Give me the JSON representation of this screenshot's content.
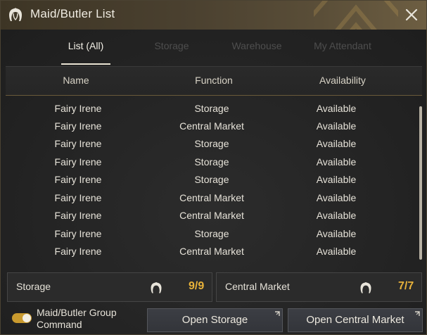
{
  "window": {
    "title": "Maid/Butler List",
    "title_icon": "maid-hair-icon",
    "close_icon": "close-icon"
  },
  "tabs": [
    {
      "label": "List (All)",
      "active": true
    },
    {
      "label": "Storage",
      "active": false
    },
    {
      "label": "Warehouse",
      "active": false
    },
    {
      "label": "My Attendant",
      "active": false
    }
  ],
  "table": {
    "headers": [
      "Name",
      "Function",
      "Availability"
    ],
    "rows": [
      {
        "name": "Fairy Irene",
        "function": "Storage",
        "availability": "Available"
      },
      {
        "name": "Fairy Irene",
        "function": "Central Market",
        "availability": "Available"
      },
      {
        "name": "Fairy Irene",
        "function": "Storage",
        "availability": "Available"
      },
      {
        "name": "Fairy Irene",
        "function": "Storage",
        "availability": "Available"
      },
      {
        "name": "Fairy Irene",
        "function": "Storage",
        "availability": "Available"
      },
      {
        "name": "Fairy Irene",
        "function": "Central Market",
        "availability": "Available"
      },
      {
        "name": "Fairy Irene",
        "function": "Central Market",
        "availability": "Available"
      },
      {
        "name": "Fairy Irene",
        "function": "Storage",
        "availability": "Available"
      },
      {
        "name": "Fairy Irene",
        "function": "Central Market",
        "availability": "Available"
      }
    ]
  },
  "summary": {
    "storage": {
      "label": "Storage",
      "count": "9/9",
      "icon": "maid-hair-icon"
    },
    "market": {
      "label": "Central Market",
      "count": "7/7",
      "icon": "maid-hair-icon"
    }
  },
  "footer": {
    "toggle_label": "Maid/Butler Group Command",
    "toggle_on": true,
    "open_storage": "Open Storage",
    "open_market": "Open Central Market"
  },
  "colors": {
    "accent_gold": "#e8b23a",
    "toggle_on": "#c99a2e",
    "title_bar": "#4b4130"
  }
}
